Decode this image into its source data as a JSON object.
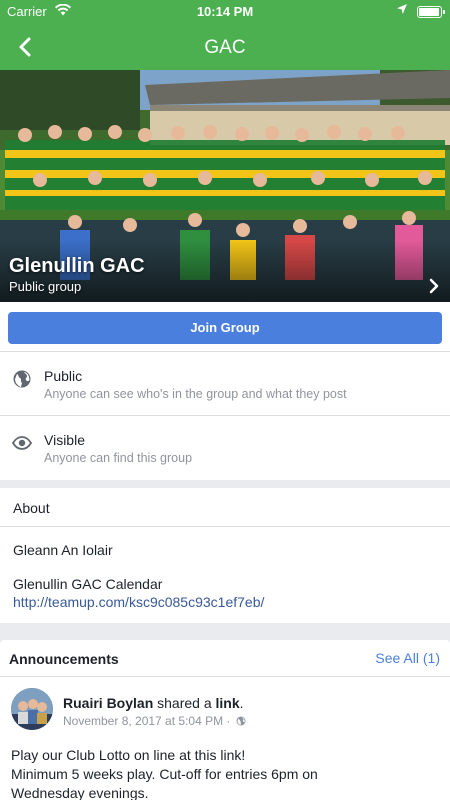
{
  "status_bar": {
    "carrier": "Carrier",
    "time": "10:14 PM"
  },
  "nav": {
    "title": "GAC",
    "back_icon": "chevron-left-icon"
  },
  "group": {
    "name": "Glenullin GAC",
    "privacy_label": "Public group",
    "join_label": "Join Group"
  },
  "info_rows": [
    {
      "icon": "globe-icon",
      "title": "Public",
      "subtitle": "Anyone can see who's in the group and what they post"
    },
    {
      "icon": "eye-icon",
      "title": "Visible",
      "subtitle": "Anyone can find this group"
    }
  ],
  "about": {
    "heading": "About",
    "line1": "Gleann An Iolair",
    "line2": "Glenullin GAC Calendar",
    "link": "http://teamup.com/ksc9c085c93c1ef7eb/"
  },
  "announcements": {
    "heading": "Announcements",
    "see_all": "See All (1)",
    "post": {
      "author": "Ruairi Boylan",
      "action": "shared a",
      "object": "link",
      "timestamp": "November 8, 2017 at 5:04 PM ·",
      "body_line1": "Play our Club Lotto on line at this link!",
      "body_line2": "Minimum 5 weeks play. Cut-off for entries 6pm on",
      "body_line3": "Wednesday evenings."
    }
  },
  "colors": {
    "header_green": "#4caf50",
    "join_blue": "#4a7fdd",
    "link_blue": "#385898",
    "kit_green": "#1e7d32",
    "kit_gold": "#f2c418"
  }
}
